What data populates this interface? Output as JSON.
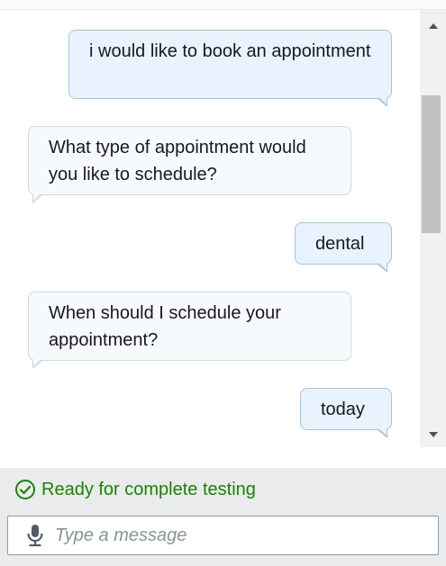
{
  "messages": [
    {
      "role": "user",
      "text": "i would like to book an appointment"
    },
    {
      "role": "bot",
      "text": "What type of appointment would you like to schedule?"
    },
    {
      "role": "user",
      "text": "dental"
    },
    {
      "role": "bot",
      "text": "When should I schedule your appointment?"
    },
    {
      "role": "user",
      "text": "today"
    }
  ],
  "status": {
    "text": "Ready for complete testing",
    "color": "#1d8102",
    "icon": "check-circle-icon"
  },
  "composer": {
    "placeholder": "Type a message",
    "icon": "microphone-icon"
  }
}
